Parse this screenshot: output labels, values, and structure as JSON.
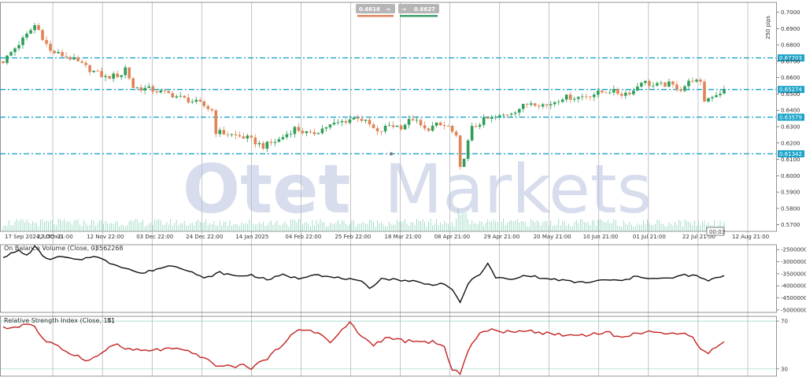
{
  "watermark": {
    "brand_a": "Otet",
    "brand_b": "Markets"
  },
  "quote": {
    "bid": "0.6616",
    "ask": "0.6627",
    "bid_arrow": "→",
    "ask_arrow": "→",
    "bid_color": "#e0845c",
    "ask_color": "#3f9e6e"
  },
  "right_label": "250 pips",
  "tag_time": "00:03",
  "colors": {
    "bull": "#2e9e58",
    "bear": "#e08458",
    "level": "#1ba3c9",
    "obv": "#111111",
    "rsi": "#c42323"
  },
  "chart_data": [
    {
      "type": "candlestick",
      "title": "",
      "y_ticks": [
        "0.7000",
        "0.6900",
        "0.6800",
        "0.6700",
        "0.6600",
        "0.6500",
        "0.6400",
        "0.6300",
        "0.6200",
        "0.6100",
        "0.6000",
        "0.5900",
        "0.5800",
        "0.5700"
      ],
      "ylim": [
        0.566,
        0.706
      ],
      "x_ticks": [
        "17 Sep 2024, UTC+0",
        "22 Oct 21:00",
        "12 Nov 22:00",
        "03 Dec 22:00",
        "24 Dec 22:00",
        "14 Jan 2025",
        "04 Feb 22:00",
        "25 Feb 22:00",
        "18 Mar 21:00",
        "08 Apr 21:00",
        "29 Apr 21:00",
        "20 May 21:00",
        "10 Jun 21:00",
        "01 Jul 21:00",
        "22 Jul 21:00",
        "12 Aug 21:00"
      ],
      "levels": [
        {
          "label": "0.67203",
          "value": 0.67203
        },
        {
          "label": "0.65274",
          "value": 0.65274
        },
        {
          "label": "0.63579",
          "value": 0.63579
        },
        {
          "label": "0.61342",
          "value": 0.61342
        }
      ],
      "close_path": [
        [
          0,
          0.67
        ],
        [
          6,
          0.686
        ],
        [
          8,
          0.692
        ],
        [
          9,
          0.689
        ],
        [
          12,
          0.676
        ],
        [
          17,
          0.672
        ],
        [
          22,
          0.665
        ],
        [
          26,
          0.66
        ],
        [
          30,
          0.662
        ],
        [
          31,
          0.666
        ],
        [
          33,
          0.654
        ],
        [
          37,
          0.653
        ],
        [
          42,
          0.65
        ],
        [
          46,
          0.647
        ],
        [
          50,
          0.644
        ],
        [
          53,
          0.64
        ],
        [
          54,
          0.627
        ],
        [
          58,
          0.625
        ],
        [
          62,
          0.623
        ],
        [
          66,
          0.618
        ],
        [
          70,
          0.622
        ],
        [
          74,
          0.629
        ],
        [
          78,
          0.625
        ],
        [
          82,
          0.63
        ],
        [
          86,
          0.633
        ],
        [
          90,
          0.636
        ],
        [
          93,
          0.631
        ],
        [
          95,
          0.626
        ],
        [
          98,
          0.631
        ],
        [
          101,
          0.63
        ],
        [
          104,
          0.635
        ],
        [
          107,
          0.628
        ],
        [
          110,
          0.631
        ],
        [
          113,
          0.63
        ],
        [
          115,
          0.623
        ],
        [
          116,
          0.604
        ],
        [
          117,
          0.612
        ],
        [
          119,
          0.629
        ],
        [
          122,
          0.634
        ],
        [
          126,
          0.636
        ],
        [
          130,
          0.64
        ],
        [
          134,
          0.645
        ],
        [
          138,
          0.643
        ],
        [
          142,
          0.648
        ],
        [
          146,
          0.648
        ],
        [
          150,
          0.65
        ],
        [
          154,
          0.652
        ],
        [
          157,
          0.65
        ],
        [
          160,
          0.652
        ],
        [
          162,
          0.658
        ],
        [
          165,
          0.655
        ],
        [
          169,
          0.656
        ],
        [
          172,
          0.653
        ],
        [
          175,
          0.659
        ],
        [
          177,
          0.656
        ],
        [
          178,
          0.646
        ],
        [
          180,
          0.649
        ],
        [
          183,
          0.652
        ]
      ]
    },
    {
      "type": "line",
      "title": "On Balance Volume (Close, 0)",
      "current_value": "-3562268",
      "y_ticks": [
        "-2500000",
        "-3000000",
        "-3500000",
        "-4000000",
        "-4500000",
        "-5000000"
      ],
      "ylim": [
        -5100000,
        -2300000
      ],
      "points": [
        [
          0,
          -2800000
        ],
        [
          4,
          -2550000
        ],
        [
          6,
          -2750000
        ],
        [
          8,
          -2380000
        ],
        [
          11,
          -2900000
        ],
        [
          15,
          -2800000
        ],
        [
          19,
          -2950000
        ],
        [
          23,
          -2750000
        ],
        [
          27,
          -3050000
        ],
        [
          31,
          -3250000
        ],
        [
          35,
          -3500000
        ],
        [
          39,
          -3300000
        ],
        [
          43,
          -3150000
        ],
        [
          47,
          -3350000
        ],
        [
          51,
          -3700000
        ],
        [
          55,
          -3450000
        ],
        [
          59,
          -3600000
        ],
        [
          63,
          -3550000
        ],
        [
          67,
          -3750000
        ],
        [
          71,
          -3550000
        ],
        [
          75,
          -3700000
        ],
        [
          79,
          -3500000
        ],
        [
          83,
          -3650000
        ],
        [
          87,
          -3700000
        ],
        [
          91,
          -3850000
        ],
        [
          93,
          -4100000
        ],
        [
          96,
          -3700000
        ],
        [
          100,
          -3750000
        ],
        [
          104,
          -3800000
        ],
        [
          108,
          -3950000
        ],
        [
          112,
          -3900000
        ],
        [
          114,
          -4200000
        ],
        [
          116,
          -4700000
        ],
        [
          118,
          -3900000
        ],
        [
          121,
          -3500000
        ],
        [
          123,
          -3100000
        ],
        [
          125,
          -3650000
        ],
        [
          129,
          -3750000
        ],
        [
          133,
          -3550000
        ],
        [
          137,
          -3700000
        ],
        [
          141,
          -3750000
        ],
        [
          145,
          -3850000
        ],
        [
          149,
          -3850000
        ],
        [
          153,
          -3750000
        ],
        [
          157,
          -3800000
        ],
        [
          161,
          -3600000
        ],
        [
          165,
          -3700000
        ],
        [
          169,
          -3700000
        ],
        [
          173,
          -3550000
        ],
        [
          176,
          -3600000
        ],
        [
          179,
          -3800000
        ],
        [
          183,
          -3560000
        ]
      ]
    },
    {
      "type": "line",
      "title": "Relative Strength Index (Close, 14)",
      "current_value": "51",
      "y_ticks": [
        "70",
        "30"
      ],
      "ylim": [
        24,
        74
      ],
      "points": [
        [
          0,
          64
        ],
        [
          3,
          65
        ],
        [
          6,
          68
        ],
        [
          8,
          66
        ],
        [
          10,
          55
        ],
        [
          14,
          48
        ],
        [
          18,
          42
        ],
        [
          22,
          37
        ],
        [
          25,
          43
        ],
        [
          28,
          51
        ],
        [
          31,
          47
        ],
        [
          35,
          45
        ],
        [
          39,
          46
        ],
        [
          43,
          47
        ],
        [
          47,
          44
        ],
        [
          51,
          40
        ],
        [
          53,
          34
        ],
        [
          57,
          32
        ],
        [
          61,
          33
        ],
        [
          63,
          31
        ],
        [
          65,
          35
        ],
        [
          68,
          41
        ],
        [
          72,
          55
        ],
        [
          75,
          62
        ],
        [
          78,
          63
        ],
        [
          81,
          58
        ],
        [
          83,
          52
        ],
        [
          86,
          62
        ],
        [
          88,
          69
        ],
        [
          91,
          57
        ],
        [
          94,
          50
        ],
        [
          97,
          56
        ],
        [
          101,
          54
        ],
        [
          105,
          52
        ],
        [
          109,
          53
        ],
        [
          112,
          48
        ],
        [
          114,
          28
        ],
        [
          116,
          27
        ],
        [
          118,
          46
        ],
        [
          121,
          60
        ],
        [
          125,
          63
        ],
        [
          129,
          60
        ],
        [
          133,
          63
        ],
        [
          137,
          60
        ],
        [
          141,
          59
        ],
        [
          145,
          58
        ],
        [
          149,
          59
        ],
        [
          153,
          61
        ],
        [
          157,
          56
        ],
        [
          161,
          60
        ],
        [
          164,
          62
        ],
        [
          168,
          58
        ],
        [
          172,
          61
        ],
        [
          175,
          58
        ],
        [
          177,
          46
        ],
        [
          179,
          44
        ],
        [
          183,
          52
        ]
      ]
    }
  ]
}
